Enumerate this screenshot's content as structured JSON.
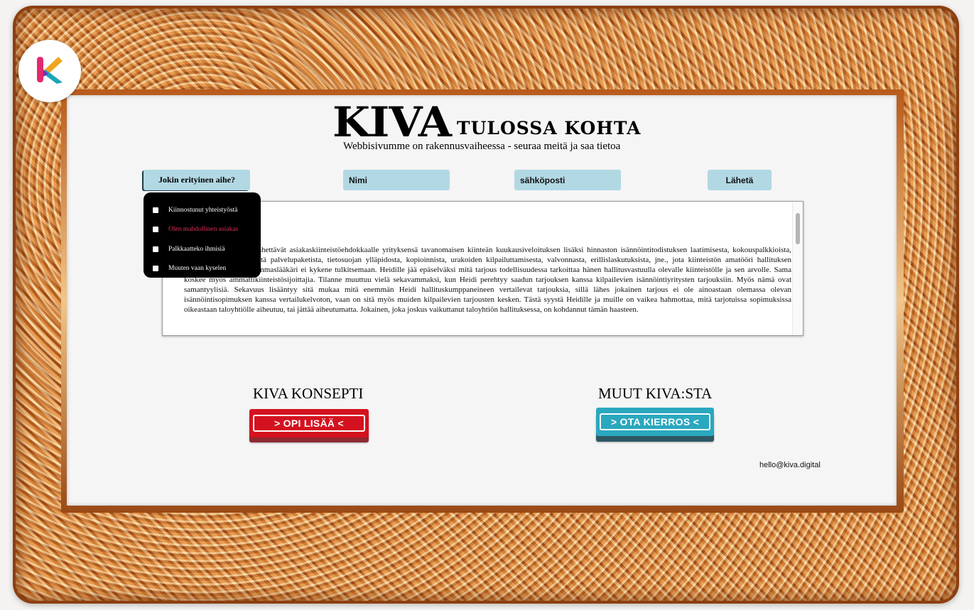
{
  "brand": {
    "title": "KIVA",
    "tagline": "TULOSSA KOHTA",
    "subtitle": "Webbisivumme on rakennusvaiheessa - seuraa meitä ja saa tietoa",
    "logo_colors": [
      "#f0a520",
      "#e12a6e",
      "#1aa6b8",
      "#7a2bb8"
    ]
  },
  "form": {
    "topic_button_label": "Jokin erityinen aihe?",
    "name_placeholder": "Nimi",
    "email_placeholder": "sähköposti",
    "send_label": "Lähetä"
  },
  "dropdown": {
    "options": [
      {
        "label": "Kiinnostunut yhteistyöstä",
        "active": false
      },
      {
        "label": "Olen mahdollinen asiakas",
        "active": true
      },
      {
        "label": "Palkkaatteko ihmisiä",
        "active": false
      },
      {
        "label": "Muuten vaan kyselen",
        "active": false
      }
    ],
    "active_color": "#e0305a"
  },
  "article": {
    "body": "sa isännöintitoimistot lähettävät asiakaskiinteistöehdokkaalle yrityksensä tavanomaisen kiinteän kuukausiveloituksen lisäksi hinnaston isännöintitodistuksen laatimisesta, kokouspalkkioista, kirjanpidosta, sähköisestä palvelupaketista, tietosuojan ylläpidosta, kopioinnista, urakoiden kilpailuttamisesta, valvonnasta, erillislaskutuksista, jne., jota kiinteistön amatööri hallituksen puheenjohtaja Heidi-hammaslääkäri ei kykene tulkitsemaan. Heidille jää epäselväksi mitä tarjous todellisuudessa tarkoittaa hänen hallitusvastuulla olevalle kiinteistölle ja sen arvolle. Sama koskee myös ammattikiinteistösijoittajia. Tilanne muuttuu vielä sekavammaksi, kun Heidi perehtyy saadun tarjouksen kanssa kilpailevien isännöintiyritysten tarjouksiin. Myös nämä ovat samantyylisiä. Sekavuus lisääntyy sitä mukaa mitä enemmän Heidi hallituskumppaneineen vertailevat tarjouksia, sillä lähes jokainen tarjous ei ole ainoastaan olemassa olevan isännöintisopimuksen kanssa vertailukelvoton, vaan on sitä myös muiden kilpailevien tarjousten kesken. Tästä syystä Heidille ja muille on vaikea hahmottaa, mitä tarjotuissa sopimuksissa oikeastaan taloyhtiölle aiheutuu, tai jättää aiheutumatta. Jokainen, joka joskus vaikuttanut taloyhtiön hallituksessa, on kohdannut tämän haasteen."
  },
  "sections": {
    "left_title": "KIVA KONSEPTI",
    "left_button": ">  OPI LISÄÄ  <",
    "right_title": "MUUT KIVA:STA",
    "right_button": ">  OTA KIERROS  <"
  },
  "contact": {
    "email": "hello@kiva.digital"
  },
  "colors": {
    "field_bg": "#b2d8e4",
    "red_button": "#d4121f",
    "teal_button": "#2aa8bf"
  }
}
